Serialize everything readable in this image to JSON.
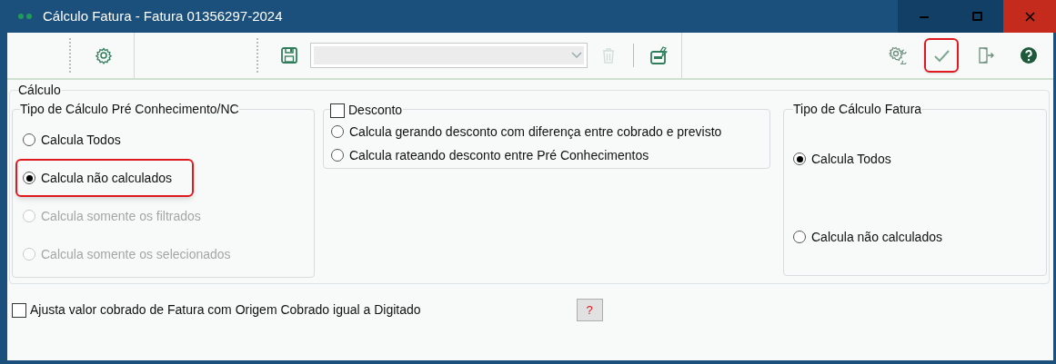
{
  "window": {
    "title": "Cálculo Fatura - Fatura 01356297-2024"
  },
  "toolbar": {
    "left": [
      {
        "kind": "gear",
        "disabled": false,
        "highlighted": false
      }
    ],
    "middle": [
      {
        "kind": "save",
        "disabled": false,
        "highlighted": false
      },
      {
        "kind": "combo",
        "disabled": true,
        "highlighted": false
      },
      {
        "kind": "trash",
        "disabled": true,
        "highlighted": false
      },
      {
        "kind": "sql",
        "disabled": false,
        "highlighted": false
      }
    ],
    "right": [
      {
        "kind": "gears",
        "disabled": false,
        "highlighted": false
      },
      {
        "kind": "check",
        "disabled": false,
        "highlighted": true
      },
      {
        "kind": "exit",
        "disabled": false,
        "highlighted": false
      },
      {
        "kind": "help",
        "disabled": false,
        "highlighted": false
      }
    ]
  },
  "section": {
    "title": "Cálculo"
  },
  "pre_group": {
    "title": "Tipo de Cálculo Pré Conhecimento/NC",
    "options": [
      {
        "label": "Calcula Todos",
        "selected": false,
        "disabled": false,
        "highlighted": false
      },
      {
        "label": "Calcula não calculados",
        "selected": true,
        "disabled": false,
        "highlighted": true
      },
      {
        "label": "Calcula somente os filtrados",
        "selected": false,
        "disabled": true,
        "highlighted": false
      },
      {
        "label": "Calcula somente os selecionados",
        "selected": false,
        "disabled": true,
        "highlighted": false
      }
    ]
  },
  "discount_group": {
    "label": "Desconto",
    "checked": false,
    "options": [
      {
        "label": "Calcula gerando desconto com diferença entre cobrado e previsto",
        "selected": false,
        "disabled": false
      },
      {
        "label": "Calcula rateando desconto entre Pré Conhecimentos",
        "selected": false,
        "disabled": false
      }
    ]
  },
  "fatura_group": {
    "title": "Tipo de Cálculo Fatura",
    "options": [
      {
        "label": "Calcula Todos",
        "selected": true,
        "disabled": false
      },
      {
        "label": "Calcula não calculados",
        "selected": false,
        "disabled": false
      }
    ]
  },
  "adjust_checkbox": {
    "label": "Ajusta valor cobrado de Fatura com Origem Cobrado igual a Digitado",
    "checked": false
  },
  "help_button": {
    "label": "?"
  }
}
